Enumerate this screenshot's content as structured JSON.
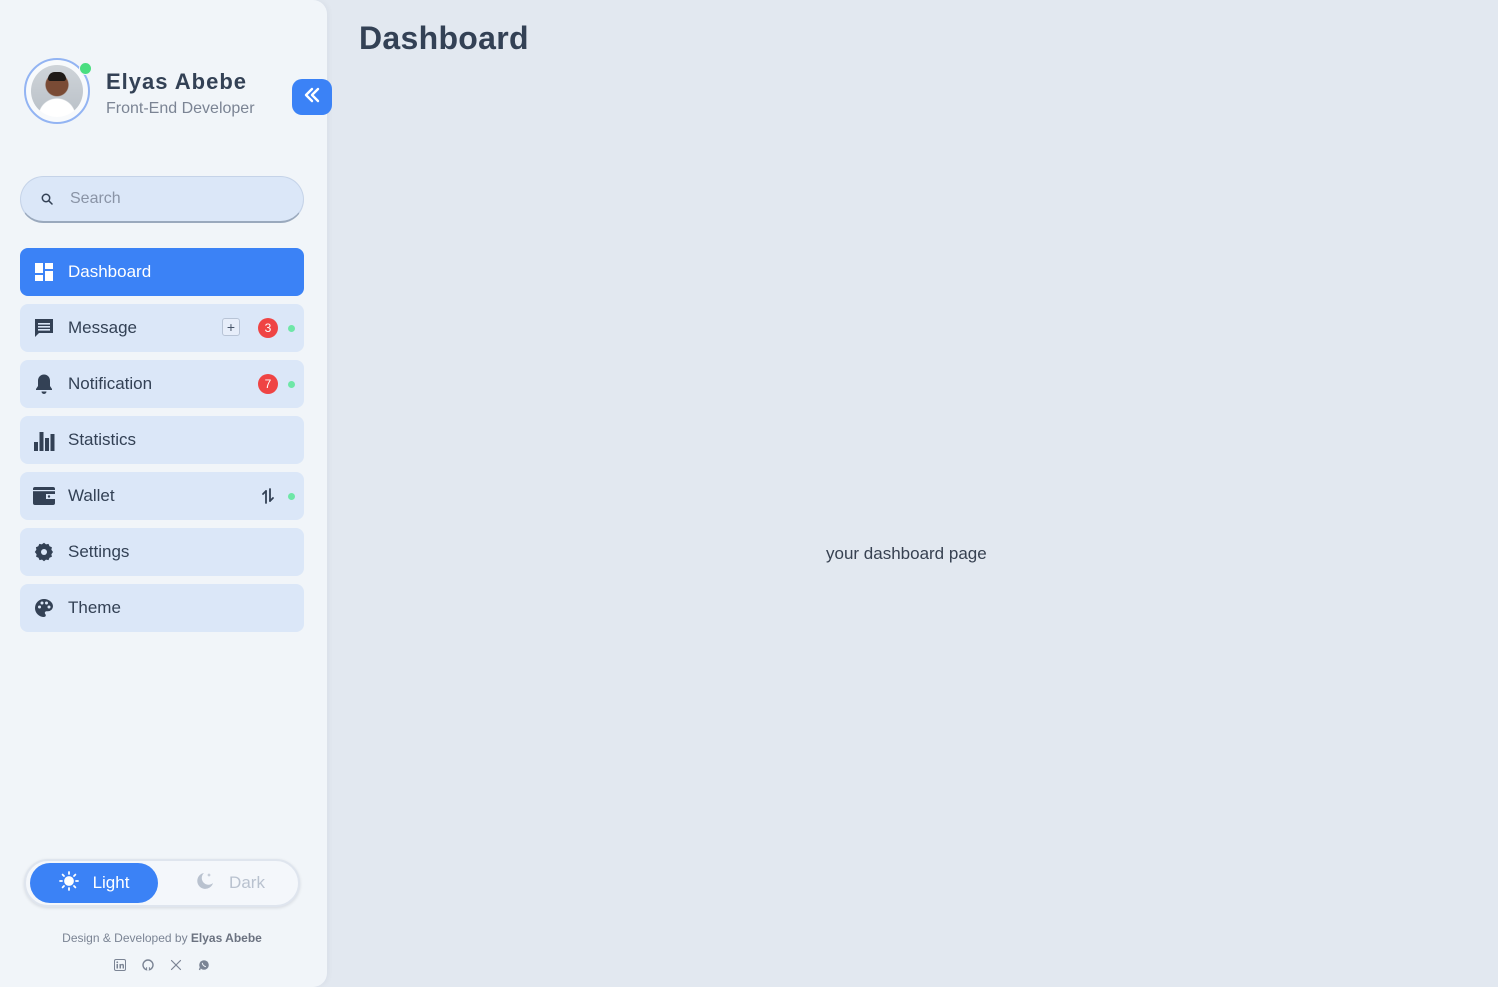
{
  "profile": {
    "name": "Elyas Abebe",
    "role": "Front-End Developer",
    "status": "online"
  },
  "sidebar": {
    "collapse_icon": "double-chevron-left-icon",
    "search": {
      "placeholder": "Search",
      "value": ""
    },
    "items": [
      {
        "label": "Dashboard",
        "icon": "dashboard-icon",
        "active": true
      },
      {
        "label": "Message",
        "icon": "message-icon",
        "badge": "3",
        "add": "+"
      },
      {
        "label": "Notification",
        "icon": "bell-icon",
        "badge": "7"
      },
      {
        "label": "Statistics",
        "icon": "bar-chart-icon"
      },
      {
        "label": "Wallet",
        "icon": "wallet-icon",
        "extra_icon": "transfer-icon"
      },
      {
        "label": "Settings",
        "icon": "gear-icon"
      },
      {
        "label": "Theme",
        "icon": "palette-icon"
      }
    ],
    "theme_toggle": {
      "light_label": "Light",
      "dark_label": "Dark",
      "selected": "Light"
    },
    "credit": {
      "prefix": "Design & Developed by ",
      "author": "Elyas Abebe"
    },
    "socials": [
      "linkedin-icon",
      "github-icon",
      "x-icon",
      "whatsapp-icon"
    ]
  },
  "main": {
    "title": "Dashboard",
    "body_text": "your dashboard page"
  },
  "colors": {
    "accent": "#3b82f6",
    "badge": "#ef4444",
    "online": "#4ade80",
    "background": "#e2e8f0",
    "sidebar": "#f1f5f9"
  }
}
